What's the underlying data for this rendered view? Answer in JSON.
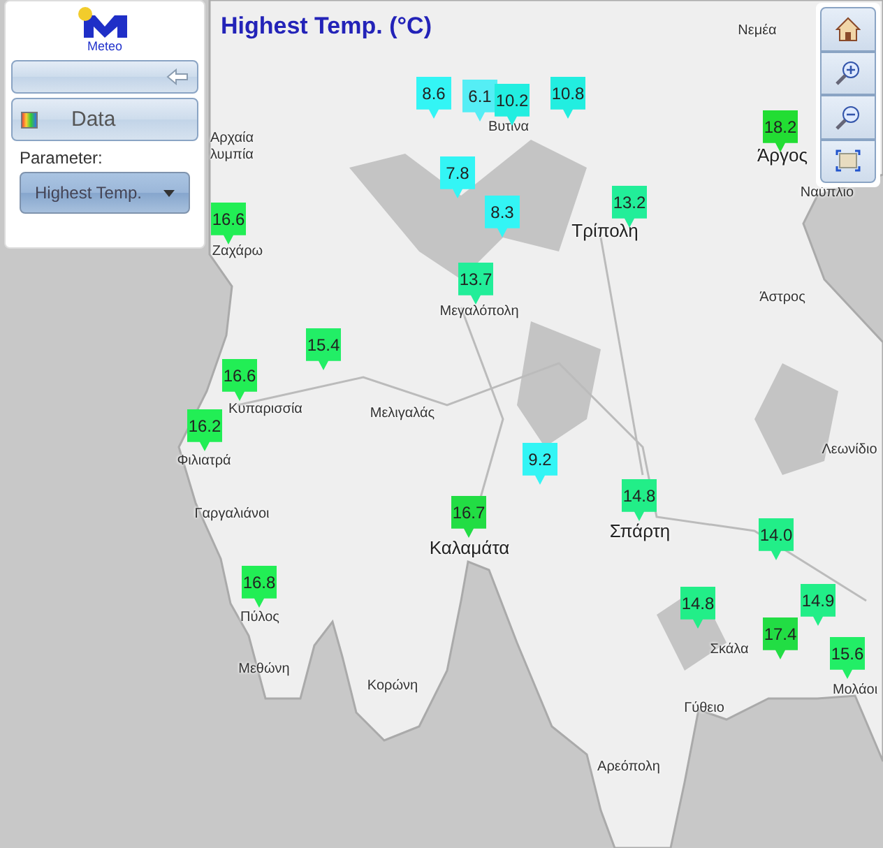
{
  "panel": {
    "logo_text": "Meteo",
    "data_button": {
      "label": "Data"
    },
    "parameter": {
      "label": "Parameter:",
      "value": "Highest Temp."
    }
  },
  "map_title": "Highest Temp. (°C)",
  "stations": [
    {
      "value": "8.6",
      "color": "#33f5f5"
    },
    {
      "value": "6.1",
      "color": "#55eef5"
    },
    {
      "value": "10.2",
      "color": "#22eee0"
    },
    {
      "value": "10.8",
      "color": "#22eee0"
    },
    {
      "value": "7.8",
      "color": "#33f5f5"
    },
    {
      "value": "8.3",
      "color": "#33f5f5"
    },
    {
      "value": "13.2",
      "color": "#22ee99"
    },
    {
      "value": "18.2",
      "color": "#22dd33"
    },
    {
      "value": "16.6",
      "color": "#22ee55"
    },
    {
      "value": "13.7",
      "color": "#22ee99"
    },
    {
      "value": "15.4",
      "color": "#22ee66"
    },
    {
      "value": "16.6",
      "color": "#22ee55"
    },
    {
      "value": "16.2",
      "color": "#22ee55"
    },
    {
      "value": "9.2",
      "color": "#33f5f5"
    },
    {
      "value": "16.7",
      "color": "#22dd44"
    },
    {
      "value": "14.8",
      "color": "#22ee88"
    },
    {
      "value": "14.0",
      "color": "#22ee88"
    },
    {
      "value": "16.8",
      "color": "#22ee55"
    },
    {
      "value": "14.8",
      "color": "#22ee88"
    },
    {
      "value": "14.9",
      "color": "#22ee88"
    },
    {
      "value": "17.4",
      "color": "#22dd44"
    },
    {
      "value": "15.6",
      "color": "#22ee66"
    }
  ],
  "places": [
    {
      "name": "Νεμέα",
      "kind": "minor"
    },
    {
      "name": "Βυτίνα",
      "kind": "minor"
    },
    {
      "name": "Άργος",
      "kind": "major"
    },
    {
      "name": "Ναύπλιο",
      "kind": "minor"
    },
    {
      "name": "Τρίπολη",
      "kind": "major"
    },
    {
      "name": "Αρχαία",
      "kind": "minor"
    },
    {
      "name": "λυμπία",
      "kind": "minor"
    },
    {
      "name": "Ζαχάρω",
      "kind": "minor"
    },
    {
      "name": "Μεγαλόπολη",
      "kind": "minor"
    },
    {
      "name": "Άστρος",
      "kind": "minor"
    },
    {
      "name": "Κυπαρισσία",
      "kind": "minor"
    },
    {
      "name": "Μελιγαλάς",
      "kind": "minor"
    },
    {
      "name": "Φιλιατρά",
      "kind": "minor"
    },
    {
      "name": "Λεωνίδιο",
      "kind": "minor"
    },
    {
      "name": "Γαργαλιάνοι",
      "kind": "minor"
    },
    {
      "name": "Καλαμάτα",
      "kind": "major"
    },
    {
      "name": "Σπάρτη",
      "kind": "major"
    },
    {
      "name": "Πύλος",
      "kind": "minor"
    },
    {
      "name": "Σκάλα",
      "kind": "minor"
    },
    {
      "name": "Μολάοι",
      "kind": "minor"
    },
    {
      "name": "Μεθώνη",
      "kind": "minor"
    },
    {
      "name": "Κορώνη",
      "kind": "minor"
    },
    {
      "name": "Γύθειο",
      "kind": "minor"
    },
    {
      "name": "Αρεόπολη",
      "kind": "minor"
    }
  ]
}
